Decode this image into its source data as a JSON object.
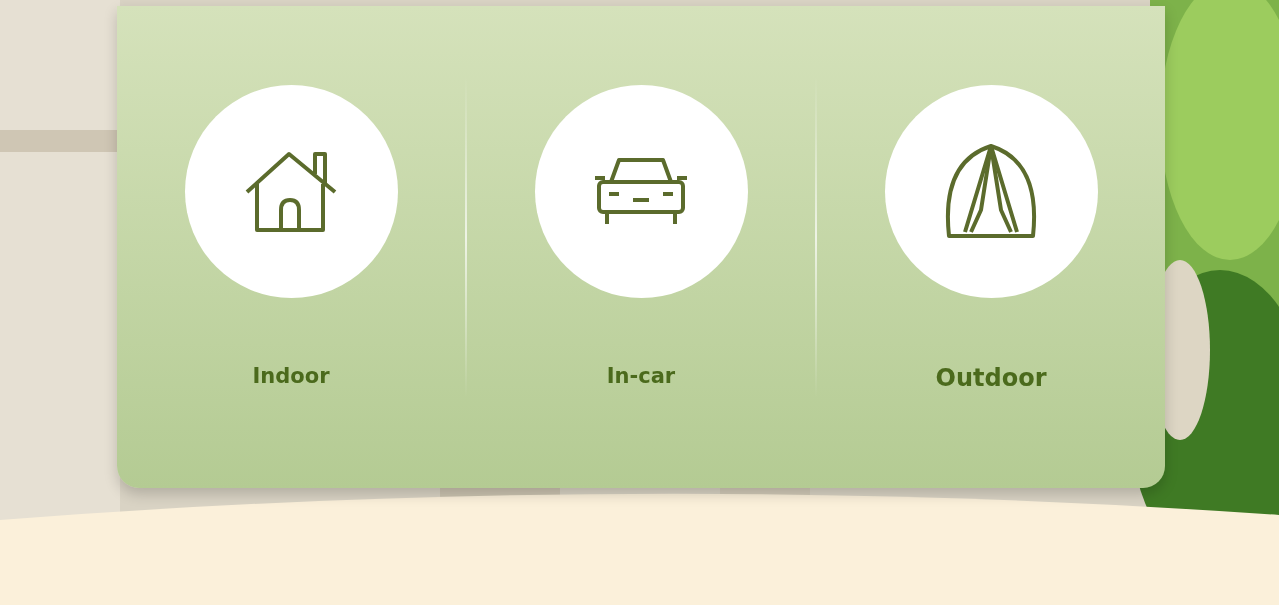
{
  "options": [
    {
      "kind": "house",
      "label": "Indoor"
    },
    {
      "kind": "car",
      "label": "In-car"
    },
    {
      "kind": "tent",
      "label": "Outdoor"
    }
  ]
}
